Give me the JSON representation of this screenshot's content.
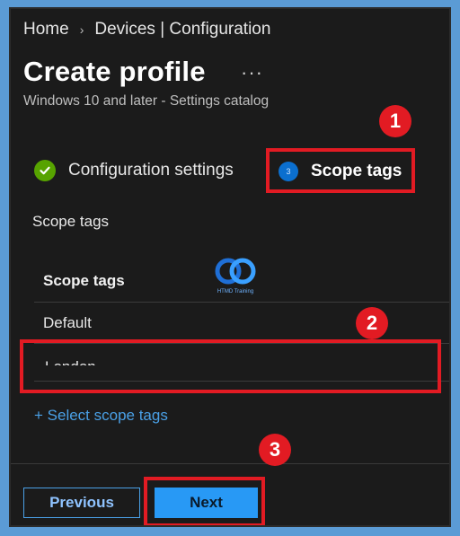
{
  "breadcrumb": {
    "home": "Home",
    "separator": "›",
    "devices": "Devices | Configuration"
  },
  "header": {
    "title": "Create profile",
    "ellipsis": "···",
    "subtitle": "Windows 10 and later - Settings catalog"
  },
  "steps": {
    "configuration": {
      "label": "Configuration settings",
      "status_icon": "check-icon"
    },
    "scope": {
      "number": "3",
      "label": "Scope tags"
    }
  },
  "section": {
    "label": "Scope tags"
  },
  "table": {
    "header": "Scope tags",
    "rows": [
      "Default",
      "London"
    ]
  },
  "select_link": "+ Select scope tags",
  "buttons": {
    "previous": "Previous",
    "next": "Next"
  },
  "annotations": {
    "badge1": "1",
    "badge2": "2",
    "badge3": "3"
  },
  "watermark": {
    "text": "HTMD Training"
  },
  "colors": {
    "accent": "#2899f5",
    "highlight": "#e21b23",
    "success": "#57a300",
    "background": "#1b1b1b"
  }
}
